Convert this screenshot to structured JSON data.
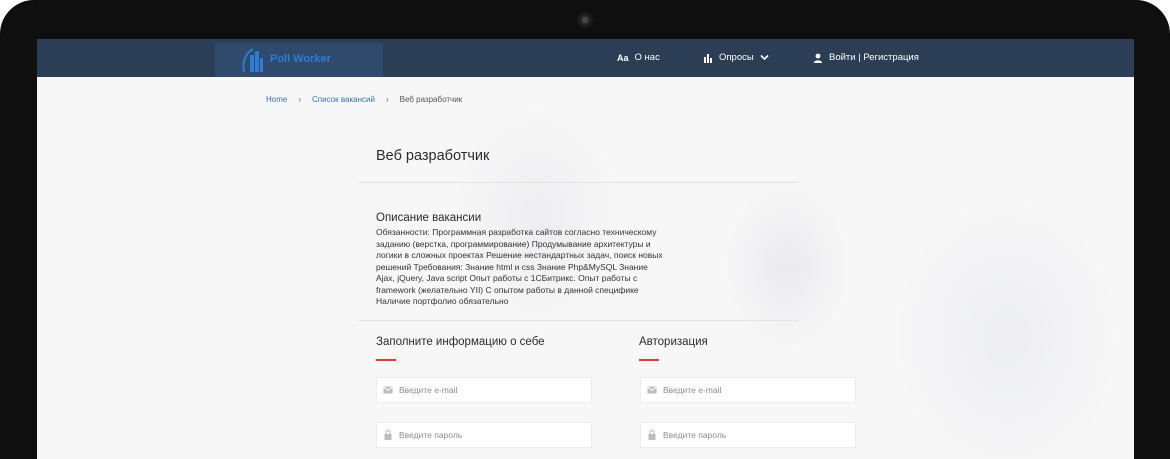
{
  "header": {
    "logo_text": "Poll Worker",
    "about_icon_text": "Aa",
    "about_label": "О нас",
    "polls_label": "Опросы",
    "auth_label": "Войти | Регистрация"
  },
  "breadcrumb": {
    "home": "Home",
    "sep1": "›",
    "list": "Список вакансий",
    "sep2": "›",
    "current": "Веб разработчик"
  },
  "vacancy": {
    "title": "Веб разработчик",
    "description_heading": "Описание вакансии",
    "description": "Обязанности: Программная разработка сайтов согласно техническому заданию (верстка, программирование) Продумывание архитектуры и логики в сложных проектах Решение нестандартных задач, поиск новых решений Требования: Знание html и css Знание Php&MySQL Знание Ajax, jQuery, Java script Опыт работы с 1СБитрикс. Опыт работы с framework (желательно YII) С опытом работы в данной специфике Наличие портфолио обязательно"
  },
  "form_info": {
    "heading": "Заполните информацию о себе",
    "email_placeholder": "Введите e-mail",
    "password_placeholder": "Введите пароль"
  },
  "form_auth": {
    "heading": "Авторизация",
    "email_placeholder": "Введите e-mail",
    "password_placeholder": "Введите пароль"
  },
  "colors": {
    "navbar": "#2c3e55",
    "accent": "#e03c31",
    "link": "#3b6fa8"
  }
}
